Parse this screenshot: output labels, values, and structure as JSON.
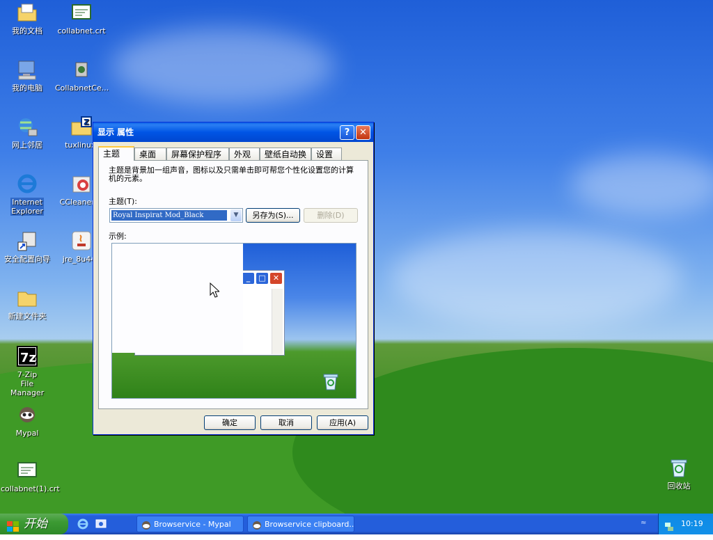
{
  "desktop": {
    "icons": [
      {
        "label": "我的文档"
      },
      {
        "label": "collabnet.crt"
      },
      {
        "label": "我的电脑"
      },
      {
        "label": "CollabnetCe..."
      },
      {
        "label": "网上邻居"
      },
      {
        "label": "tuxlinux."
      },
      {
        "label": "Internet Explorer"
      },
      {
        "label": "CCleaner_S"
      },
      {
        "label": "安全配置向导"
      },
      {
        "label": "jre_8u441"
      },
      {
        "label": "新建文件夹"
      },
      {
        "label": "7-Zip File Manager"
      },
      {
        "label": "Mypal"
      },
      {
        "label": "collabnet(1).crt"
      },
      {
        "label": "回收站"
      }
    ]
  },
  "dialog": {
    "title": "显示 属性",
    "tabs": [
      "主题",
      "桌面",
      "屏幕保护程序",
      "外观",
      "壁纸自动换",
      "设置"
    ],
    "active_tab": "主题",
    "description": "主题是背景加一组声音，图标以及只需单击即可帮您个性化设置您的计算机的元素。",
    "theme_label": "主题(T):",
    "theme_value": "Royal Inspirat Mod_Black",
    "save_as_label": "另存为(S)...",
    "delete_label": "删除(D)",
    "sample_label": "示例:",
    "ok_label": "确定",
    "cancel_label": "取消",
    "apply_label": "应用(A)"
  },
  "taskbar": {
    "start_label": "开始",
    "tasks": [
      {
        "label": "Browservice - Mypal"
      },
      {
        "label": "Browservice clipboard..."
      }
    ],
    "clock": "10:19"
  },
  "colors": {
    "title_blue": "#0055e5",
    "dialog_bg": "#ece9d8",
    "selection": "#316ac5"
  }
}
